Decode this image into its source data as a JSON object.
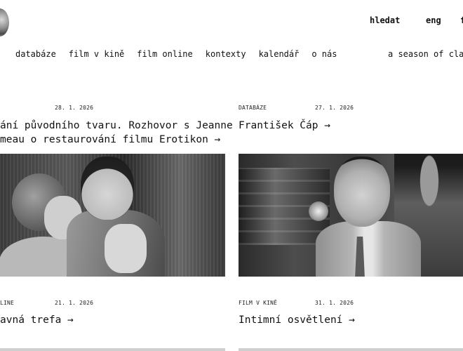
{
  "header": {
    "search_label": "hledat",
    "lang_label": "eng",
    "extra_label": "f"
  },
  "nav": {
    "items": [
      "databáze",
      "film v kině",
      "film online",
      "kontexty",
      "kalendář",
      "o nás"
    ],
    "right_label": "a season of classic"
  },
  "articles": [
    {
      "category": "",
      "date": "28. 1. 2026",
      "title_lines": [
        "ání původního tvaru. Rozhovor s Jeanne",
        "meau o restaurování filmu Erotikon →"
      ]
    },
    {
      "category": "DATABÁZE",
      "date": "27. 1. 2026",
      "title_lines": [
        "František Čáp →"
      ]
    },
    {
      "category": "LINE",
      "date": "21. 1. 2026",
      "title_lines": [
        "avná trefa →"
      ]
    },
    {
      "category": "FILM V KINĚ",
      "date": "31. 1. 2026",
      "title_lines": [
        "Intimní osvětlení →"
      ]
    }
  ]
}
